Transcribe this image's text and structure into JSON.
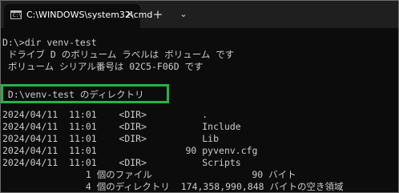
{
  "window": {
    "tab_title": "C:\\WINDOWS\\system32\\cmd",
    "tab_icon_glyph": "C:\\",
    "close_glyph": "✕",
    "new_tab_glyph": "+",
    "dropdown_glyph": "⌄",
    "highlight_color": "#26b24b"
  },
  "console": {
    "lines": [
      "D:\\>dir venv-test",
      " ドライブ D のボリューム ラベルは ボリューム です",
      " ボリューム シリアル番号は 02C5-F06D です",
      "",
      " D:\\venv-test のディレクトリ",
      "",
      "2024/04/11  11:01    <DIR>          .",
      "2024/04/11  11:01    <DIR>          Include",
      "2024/04/11  11:01    <DIR>          Lib",
      "2024/04/11  11:01                90 pyvenv.cfg",
      "2024/04/11  11:01    <DIR>          Scripts",
      "               1 個のファイル                  90 バイト",
      "               4 個のディレクトリ  174,358,990,848 バイトの空き領域"
    ]
  }
}
